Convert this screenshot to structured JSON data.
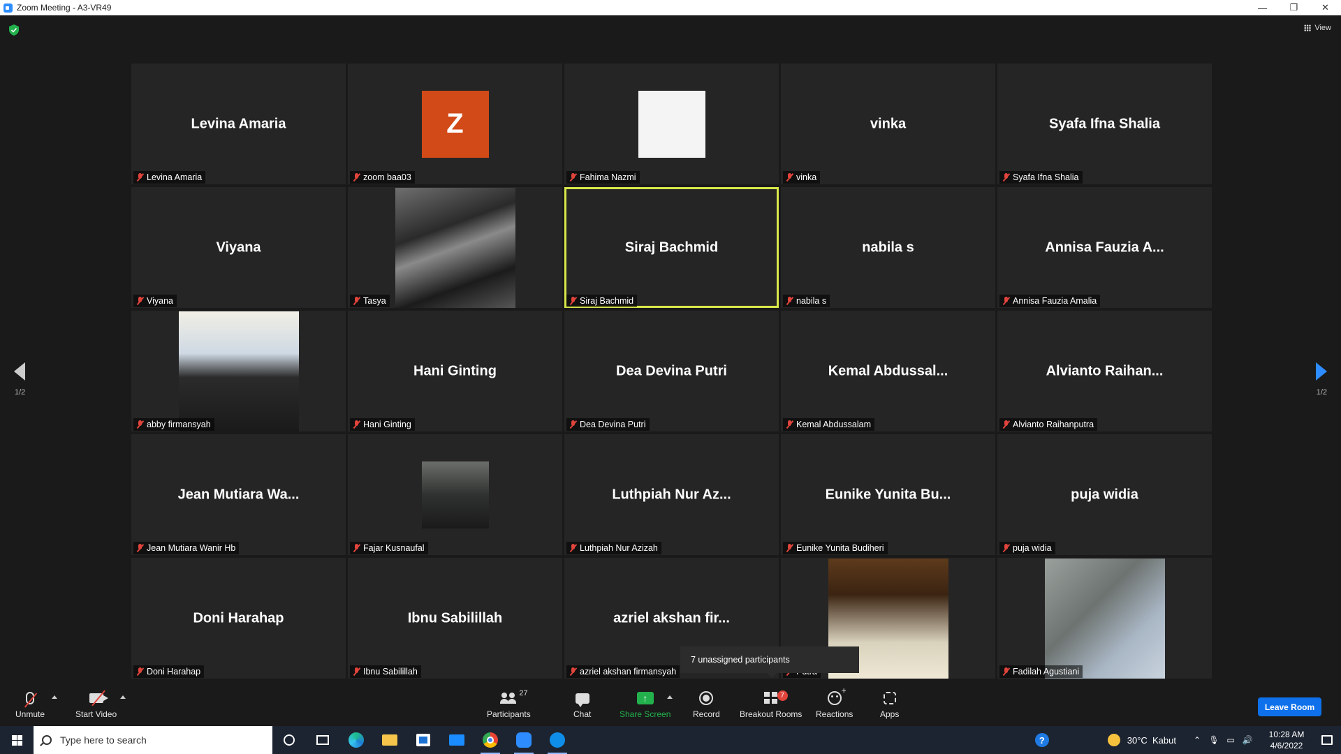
{
  "window": {
    "title": "Zoom Meeting - A3-VR49",
    "controls": {
      "minimize": "—",
      "restore": "❐",
      "close": "✕"
    }
  },
  "header": {
    "view_label": "View",
    "security_icon": "shield-icon"
  },
  "pagination": {
    "left_label": "1/2",
    "right_label": "1/2",
    "right_arrow_color": "#2d8cff"
  },
  "participants_grid": [
    {
      "display": "Levina Amaria",
      "label": "Levina Amaria"
    },
    {
      "display": "Z",
      "label": "zoom baa03",
      "avatar": "letter",
      "avatar_color": "#d14a17"
    },
    {
      "display": "",
      "label": "Fahima Nazmi",
      "avatar": "photo-hijab"
    },
    {
      "display": "vinka",
      "label": "vinka"
    },
    {
      "display": "Syafa Ifna Shalia",
      "label": "Syafa Ifna Shalia"
    },
    {
      "display": "Viyana",
      "label": "Viyana"
    },
    {
      "display": "",
      "label": "Tasya",
      "avatar": "photo-goth"
    },
    {
      "display": "Siraj Bachmid",
      "label": "Siraj Bachmid",
      "active_speaker": true
    },
    {
      "display": "nabila s",
      "label": "nabila s"
    },
    {
      "display": "Annisa Fauzia A...",
      "label": "Annisa Fauzia Amalia"
    },
    {
      "display": "",
      "label": "abby firmansyah",
      "avatar": "photo-abby"
    },
    {
      "display": "Hani Ginting",
      "label": "Hani Ginting"
    },
    {
      "display": "Dea Devina Putri",
      "label": "Dea Devina Putri"
    },
    {
      "display": "Kemal Abdussal...",
      "label": "Kemal Abdussalam"
    },
    {
      "display": "Alvianto Raihan...",
      "label": "Alvianto Raihanputra"
    },
    {
      "display": "Jean Mutiara Wa...",
      "label": "Jean Mutiara Wanir Hb"
    },
    {
      "display": "",
      "label": "Fajar Kusnaufal",
      "avatar": "photo-fajar"
    },
    {
      "display": "Luthpiah Nur Az...",
      "label": "Luthpiah Nur Azizah"
    },
    {
      "display": "Eunike Yunita Bu...",
      "label": "Eunike Yunita Budiheri"
    },
    {
      "display": "puja widia",
      "label": "puja widia"
    },
    {
      "display": "Doni Harahap",
      "label": "Doni Harahap"
    },
    {
      "display": "Ibnu Sabilillah",
      "label": "Ibnu Sabilillah"
    },
    {
      "display": "azriel akshan fir...",
      "label": "azriel akshan firmansyah"
    },
    {
      "display": "",
      "label": "Putra",
      "avatar": "photo-man"
    },
    {
      "display": "",
      "label": "Fadilah Agustiani",
      "avatar": "photo-shoe"
    }
  ],
  "tooltip": {
    "text": "7 unassigned participants"
  },
  "toolbar": {
    "unmute": "Unmute",
    "start_video": "Start Video",
    "participants": "Participants",
    "participants_count": "27",
    "chat": "Chat",
    "share_screen": "Share Screen",
    "record": "Record",
    "breakout_rooms": "Breakout Rooms",
    "breakout_badge": "7",
    "reactions": "Reactions",
    "apps": "Apps",
    "leave_room": "Leave Room",
    "share_color": "#23b14d",
    "leave_color": "#0e71eb"
  },
  "taskbar": {
    "search_placeholder": "Type here to search",
    "weather_temp": "30°C",
    "weather_desc": "Kabut",
    "time": "10:28 AM",
    "date": "4/6/2022",
    "help": "?",
    "apps": [
      "cortana-icon",
      "task-view-icon",
      "edge-icon",
      "file-explorer-icon",
      "store-icon",
      "mail-icon",
      "chrome-icon",
      "zoom-icon",
      "teamviewer-icon"
    ]
  }
}
